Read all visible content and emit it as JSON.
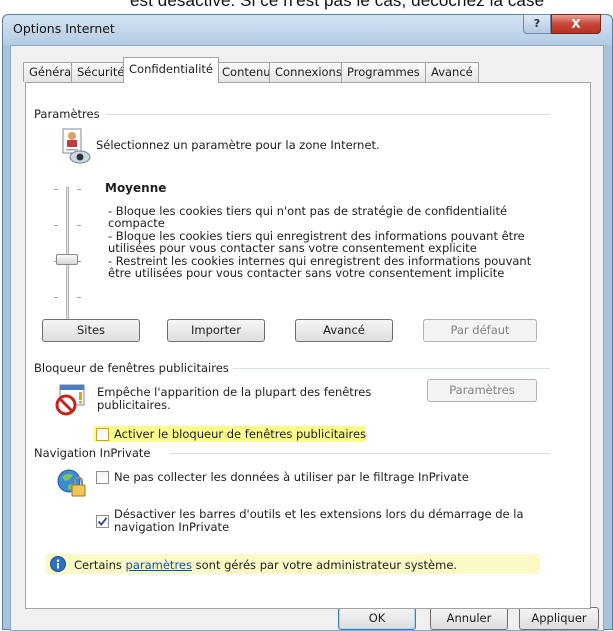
{
  "context": {
    "overlay_text": "est désactivé. Si ce n'est pas le cas, décochez la case"
  },
  "window": {
    "title": "Options Internet",
    "help_label": "?",
    "close_label": "X"
  },
  "tabs": [
    {
      "label": "Général",
      "active": false
    },
    {
      "label": "Sécurité",
      "active": false
    },
    {
      "label": "Confidentialité",
      "active": true
    },
    {
      "label": "Contenu",
      "active": false
    },
    {
      "label": "Connexions",
      "active": false
    },
    {
      "label": "Programmes",
      "active": false
    },
    {
      "label": "Avancé",
      "active": false
    }
  ],
  "privacy": {
    "group_title": "Paramètres",
    "instruction": "Sélectionnez un paramètre pour la zone Internet.",
    "level_title": "Moyenne",
    "level_value": 0.5,
    "description_lines": [
      "- Bloque les cookies tiers qui n'ont pas de stratégie de confidentialité",
      "compacte",
      "- Bloque les cookies tiers qui enregistrent des informations pouvant être",
      "utilisées pour vous contacter sans votre consentement explicite",
      "- Restreint les cookies internes qui enregistrent des informations pouvant",
      "être utilisées pour vous contacter sans votre consentement implicite"
    ],
    "buttons": {
      "sites": "Sites",
      "import": "Importer",
      "advanced": "Avancé",
      "default": "Par défaut"
    }
  },
  "popup_blocker": {
    "group_title": "Bloqueur de fenêtres publicitaires",
    "description_line1": "Empêche l'apparition de la plupart des fenêtres",
    "description_line2": "publicitaires.",
    "settings_button": "Paramètres",
    "enable_checkbox": {
      "label": "Activer le bloqueur de fenêtres publicitaires",
      "checked": false
    }
  },
  "inprivate": {
    "group_title": "Navigation InPrivate",
    "no_collect_checkbox": {
      "label": "Ne pas collecter les données à utiliser par le filtrage InPrivate",
      "checked": false
    },
    "disable_toolbars_checkbox": {
      "label_line1": "Désactiver les barres d'outils et les extensions lors du démarrage de la",
      "label_line2": "navigation InPrivate",
      "checked": true
    }
  },
  "admin_notice": {
    "prefix": "Certains",
    "link": "paramètres",
    "suffix": "sont gérés par votre administrateur système."
  },
  "footer": {
    "ok": "OK",
    "cancel": "Annuler",
    "apply": "Appliquer"
  },
  "colors": {
    "highlight": "#fbfa8c",
    "link": "#0d4fb3",
    "titlebar": "#b4cce4"
  }
}
